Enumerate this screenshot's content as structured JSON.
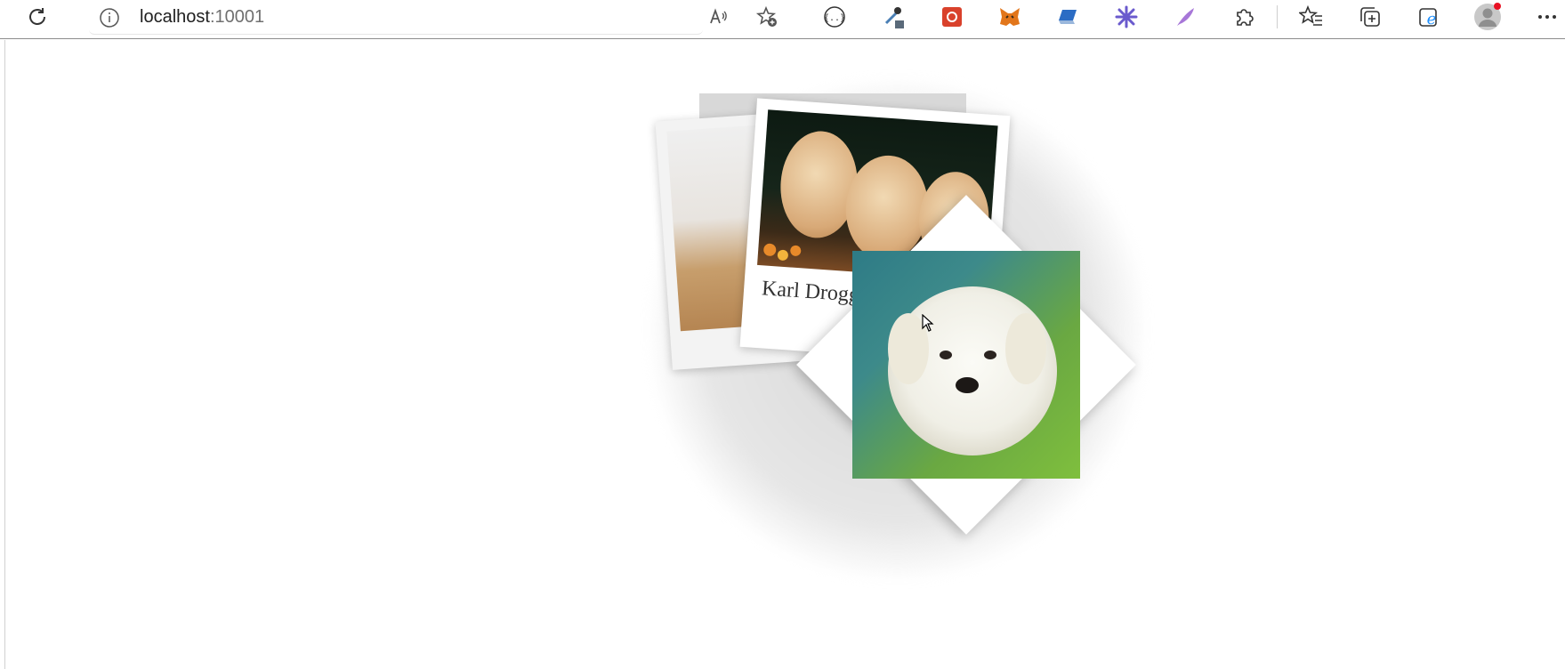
{
  "browser": {
    "url_host": "localhost",
    "url_port": ":10001",
    "icons": [
      "refresh-icon",
      "info-icon",
      "read-aloud-icon",
      "add-favorite-icon",
      "extension-braces-icon",
      "color-picker-icon",
      "extension-red-icon",
      "metamask-icon",
      "extension-blue-icon",
      "extension-snowflake-icon",
      "extension-feather-icon",
      "extensions-puzzle-icon",
      "favorites-icon",
      "collections-icon",
      "ie-mode-icon",
      "profile-icon",
      "more-icon"
    ]
  },
  "gallery": {
    "cards": [
      {
        "caption": ""
      },
      {
        "caption": "Karl Drogg"
      },
      {
        "caption": ""
      }
    ]
  },
  "colors": {
    "background": "#ffffff",
    "card": "#ffffff",
    "shadow": "#d6d6d6"
  }
}
